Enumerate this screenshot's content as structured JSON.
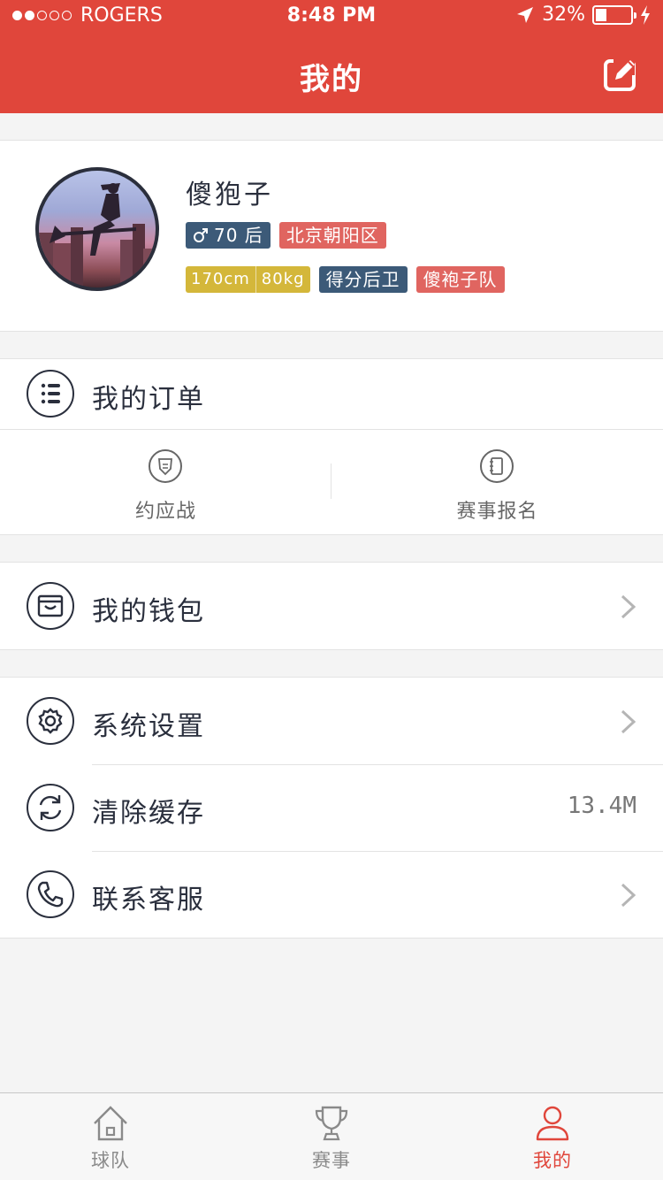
{
  "status_bar": {
    "carrier": "ROGERS",
    "time": "8:48 PM",
    "battery": "32%",
    "battery_level": 0.32,
    "signal_bars_filled": 2,
    "signal_bars_total": 5
  },
  "header": {
    "title": "我的",
    "edit_icon": "edit-icon"
  },
  "profile": {
    "nickname": "傻狍子",
    "gender_age_tag": "70 后",
    "gender_icon": "male-icon",
    "location_tag": "北京朝阳区",
    "height": "170cm",
    "weight": "80kg",
    "position_tag": "得分后卫",
    "team_tag": "傻袍子队"
  },
  "orders": {
    "label": "我的订单",
    "icon": "list-icon",
    "items": [
      {
        "label": "约应战",
        "icon": "shield-icon"
      },
      {
        "label": "赛事报名",
        "icon": "notebook-icon"
      }
    ]
  },
  "wallet": {
    "label": "我的钱包",
    "icon": "wallet-icon"
  },
  "settings": {
    "items": [
      {
        "label": "系统设置",
        "icon": "gear-icon"
      },
      {
        "label": "清除缓存",
        "icon": "refresh-icon",
        "value": "13.4M"
      },
      {
        "label": "联系客服",
        "icon": "phone-icon"
      }
    ]
  },
  "tabbar": {
    "items": [
      {
        "label": "球队",
        "icon": "home-icon",
        "active": false
      },
      {
        "label": "赛事",
        "icon": "trophy-icon",
        "active": false
      },
      {
        "label": "我的",
        "icon": "user-icon",
        "active": true
      }
    ]
  },
  "colors": {
    "accent": "#e0463b",
    "tag_blue": "#3c5a78",
    "tag_red": "#e06560",
    "tag_yellow": "#d4b73a"
  }
}
